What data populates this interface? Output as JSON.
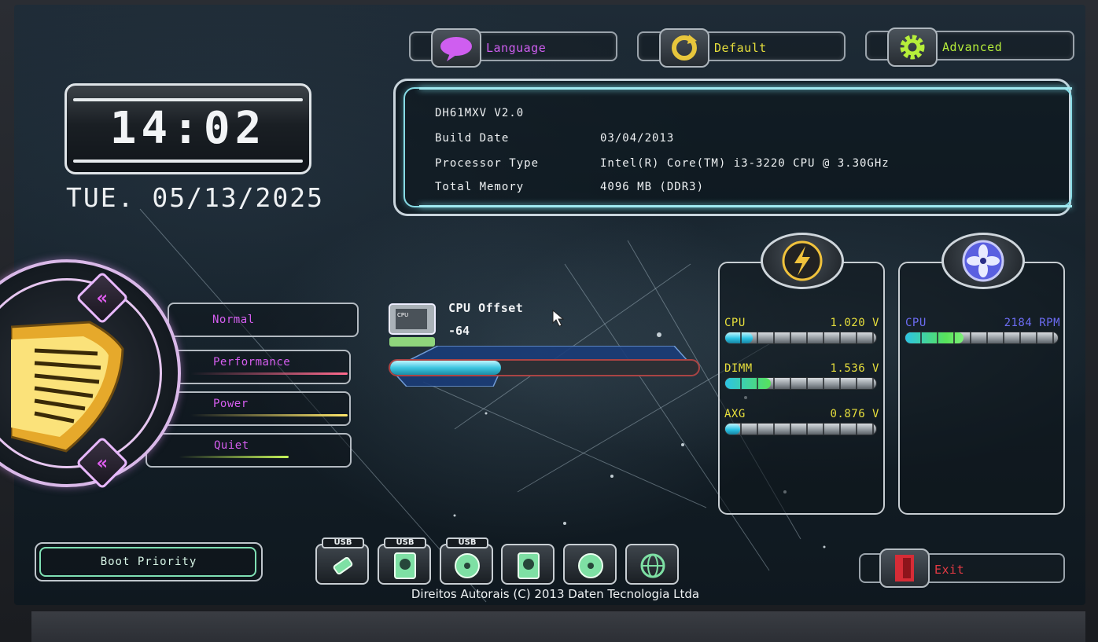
{
  "top_buttons": {
    "language": "Language",
    "default": "Default",
    "advanced": "Advanced"
  },
  "clock": {
    "time": "14:02",
    "date": "TUE. 05/13/2025"
  },
  "system_info": {
    "board": "DH61MXV V2.0",
    "rows": [
      {
        "label": "Build Date",
        "value": "03/04/2013"
      },
      {
        "label": "Processor Type",
        "value": "Intel(R) Core(TM) i3-3220 CPU @ 3.30GHz"
      },
      {
        "label": "Total Memory",
        "value": "4096 MB (DDR3)"
      }
    ]
  },
  "modes": {
    "normal": "Normal",
    "performance": "Performance",
    "power": "Power",
    "quiet": "Quiet"
  },
  "cpu_offset": {
    "label": "CPU Offset",
    "value": "-64",
    "level": 0.36
  },
  "voltages": {
    "cpu": {
      "label": "CPU",
      "value": "1.020 V",
      "level": 0.18
    },
    "dimm": {
      "label": "DIMM",
      "value": "1.536 V",
      "level": 0.3
    },
    "axg": {
      "label": "AXG",
      "value": "0.876 V",
      "level": 0.1
    }
  },
  "fan": {
    "cpu": {
      "label": "CPU",
      "value": "2184 RPM",
      "level": 0.38
    }
  },
  "boot_priority": "Boot Priority",
  "boot_devices": [
    {
      "icon": "usb-flash-icon",
      "badge": "USB"
    },
    {
      "icon": "usb-hdd-icon",
      "badge": "USB"
    },
    {
      "icon": "usb-cdrom-icon",
      "badge": "USB"
    },
    {
      "icon": "hdd-icon",
      "badge": ""
    },
    {
      "icon": "cdrom-icon",
      "badge": ""
    },
    {
      "icon": "network-icon",
      "badge": ""
    }
  ],
  "exit": "Exit",
  "copyright": "Direitos Autorais (C) 2013 Daten Tecnologia Ltda",
  "colors": {
    "accent_purple": "#d65ef0",
    "accent_yellow": "#e7df3c",
    "accent_green": "#b6ee3a",
    "accent_cyan": "#4fc9e4",
    "fan_blue": "#6c6cf2",
    "exit_red": "#e23a44"
  }
}
